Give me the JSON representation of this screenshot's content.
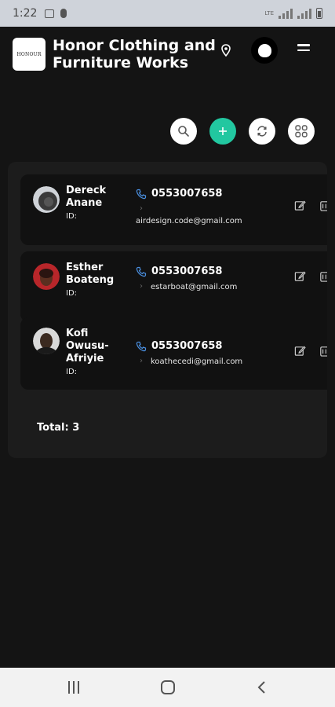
{
  "status_bar": {
    "time": "1:22",
    "network": "LTE"
  },
  "header": {
    "logo_text": "HONOUR",
    "title": "Honor Clothing and Furniture Works",
    "icons": [
      "location-icon",
      "user-avatar-icon",
      "menu-icon"
    ]
  },
  "toolbar": {
    "buttons": [
      "search-icon",
      "add-icon",
      "refresh-icon",
      "grid-view-icon"
    ],
    "accent_color": "#22c7a0"
  },
  "contacts": [
    {
      "name": "Dereck Anane",
      "id_label": "ID:",
      "phone": "0553007658",
      "email": "airdesign.code@gmail.com"
    },
    {
      "name": "Esther Boateng",
      "id_label": "ID:",
      "phone": "0553007658",
      "email": "estarboat@gmail.com"
    },
    {
      "name": "Kofi Owusu-Afriyie",
      "id_label": "ID:",
      "phone": "0553007658",
      "email": "koathecedi@gmail.com"
    }
  ],
  "footer": {
    "total_label": "Total: 3"
  },
  "colors": {
    "background": "#141414",
    "panel": "#1c1c1c",
    "card": "#111111",
    "phone_icon": "#4a8fe0"
  }
}
